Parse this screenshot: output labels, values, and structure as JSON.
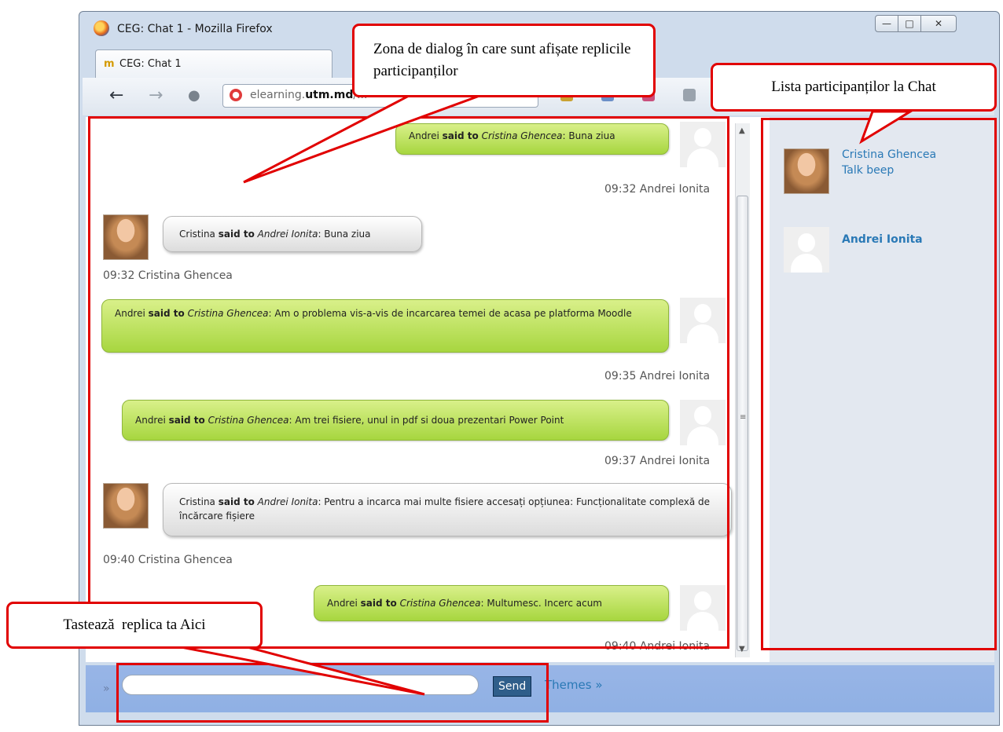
{
  "window": {
    "title": "CEG: Chat 1 - Mozilla Firefox",
    "tab_label": "CEG: Chat 1",
    "tab_icon_text": "m",
    "min_glyph": "—",
    "max_glyph": "□",
    "close_glyph": "✕"
  },
  "navbar": {
    "back_glyph": "←",
    "forward_glyph": "→",
    "identity_glyph": "●",
    "url_prefix": "elearning.",
    "url_domain": "utm.md",
    "url_suffix": "/..."
  },
  "messages": [
    {
      "from": "Andrei",
      "verb": "said to",
      "to": "Cristina Ghencea",
      "text": ": Buna ziua",
      "time": "09:32 Andrei Ionita"
    },
    {
      "from": "Cristina",
      "verb": "said to",
      "to": "Andrei Ionita",
      "text": ": Buna ziua",
      "time": "09:32 Cristina Ghencea"
    },
    {
      "from": "Andrei",
      "verb": "said to",
      "to": "Cristina Ghencea",
      "text": ": Am o problema vis-a-vis de incarcarea temei de acasa pe platforma Moodle",
      "time": "09:35 Andrei Ionita"
    },
    {
      "from": "Andrei",
      "verb": "said to",
      "to": "Cristina Ghencea",
      "text": ": Am trei fisiere, unul in pdf si doua prezentari Power Point",
      "time": "09:37 Andrei Ionita"
    },
    {
      "from": "Cristina",
      "verb": "said to",
      "to": "Andrei Ionita",
      "text": ": Pentru a incarca mai multe fisiere accesați opțiunea: Funcționalitate complexă de încărcare fișiere",
      "time": "09:40 Cristina Ghencea"
    },
    {
      "from": "Andrei",
      "verb": "said to",
      "to": "Cristina Ghencea",
      "text": ": Multumesc. Incerc acum",
      "time": "09:40 Andrei Ionita"
    }
  ],
  "participants": [
    {
      "name": "Cristina Ghencea",
      "action": "Talk beep"
    },
    {
      "name": "Andrei Ionita"
    }
  ],
  "input": {
    "chevron": "»",
    "send_label": "Send",
    "themes_label": "Themes »"
  },
  "annotations": {
    "dialog_zone": "Zona de dialog în care sunt afișate replicile participanților",
    "participants_list": "Lista participanților la Chat",
    "type_here": "Tastează  replica ta Aici"
  },
  "colors": {
    "annotation_red": "#e10000",
    "bubble_green": "#a7d63f",
    "link_blue": "#2a79b6",
    "input_bar": "#98b5e6"
  }
}
